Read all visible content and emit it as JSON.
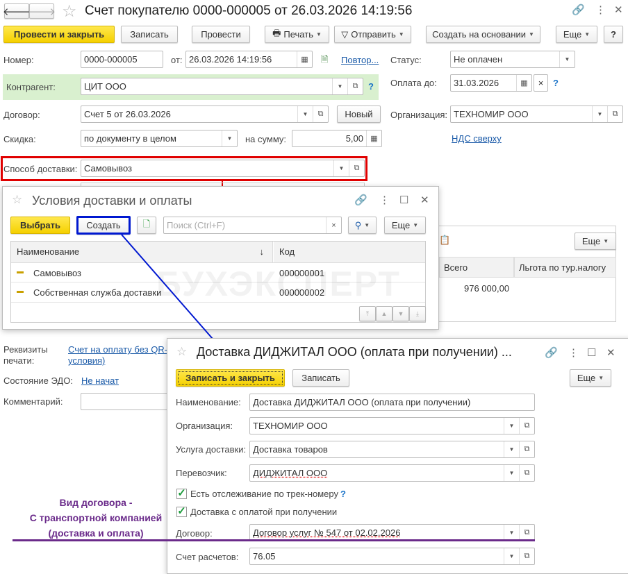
{
  "window": {
    "title": "Счет покупателю 0000-000005 от 26.03.2026 14:19:56"
  },
  "toolbar": {
    "post_close": "Провести и закрыть",
    "save": "Записать",
    "post": "Провести",
    "print": "Печать",
    "send": "Отправить",
    "create_based": "Создать на основании",
    "more": "Еще",
    "help": "?"
  },
  "form": {
    "number_label": "Номер:",
    "number": "0000-000005",
    "date_label": "от:",
    "date": "26.03.2026 14:19:56",
    "repeat_link": "Повтор...",
    "status_label": "Статус:",
    "status": "Не оплачен",
    "counterparty_label": "Контрагент:",
    "counterparty": "ЦИТ ООО",
    "help": "?",
    "pay_until_label": "Оплата до:",
    "pay_until": "31.03.2026",
    "clear": "×",
    "contract_label": "Договор:",
    "contract": "Счет 5 от 26.03.2026",
    "new_button": "Новый",
    "org_label": "Организация:",
    "org": "ТЕХНОМИР ООО",
    "discount_label": "Скидка:",
    "discount": "по документу в целом",
    "sum_label": "на сумму:",
    "sum": "5,00",
    "vat_link": "НДС сверху",
    "delivery_label": "Способ доставки:",
    "delivery": "Самовывоз",
    "print_req_label_1": "Реквизиты",
    "print_req_label_2": "печати:",
    "print_req_link_1": "Счет на оплату без QR-",
    "print_req_link_2": "условия)",
    "edo_label": "Состояние ЭДО:",
    "edo_link": "Не начат",
    "comment_label": "Комментарий:"
  },
  "background_table": {
    "more": "Еще",
    "columns": [
      "Всего",
      "Льгота по тур.налогу"
    ],
    "total": "976 000,00"
  },
  "watermark": "БУХЭКСПЕРТ",
  "dialog1": {
    "title": "Условия доставки и оплаты",
    "select": "Выбрать",
    "create": "Создать",
    "search_placeholder": "Поиск (Ctrl+F)",
    "more": "Еще",
    "columns": [
      "Наименование",
      "Код"
    ],
    "sort_icon": "↓",
    "rows": [
      {
        "name": "Самовывоз",
        "code": "000000001"
      },
      {
        "name": "Собственная служба доставки",
        "code": "000000002"
      }
    ]
  },
  "dialog2": {
    "title": "Доставка ДИДЖИТАЛ ООО (оплата при получении) ...",
    "save_close": "Записать и закрыть",
    "save": "Записать",
    "more": "Еще",
    "name_label": "Наименование:",
    "name": "Доставка ДИДЖИТАЛ ООО (оплата при получении)",
    "org_label": "Организация:",
    "org": "ТЕХНОМИР ООО",
    "service_label": "Услуга доставки:",
    "service": "Доставка товаров",
    "carrier_label": "Перевозчик:",
    "carrier": "ДИДЖИТАЛ ООО",
    "tracking": "Есть отслеживание по трек-номеру",
    "tracking_help": "?",
    "cod": "Доставка с оплатой при получении",
    "contract_label": "Договор:",
    "contract": "Договор услуг № 547 от 02.02.2026",
    "account_label": "Счет расчетов:",
    "account": "76.05"
  },
  "annotation": {
    "line1": "Вид договора -",
    "line2": "С транспортной компанией",
    "line3": "(доставка и оплата)"
  },
  "colors": {
    "yellow": "#f5d000",
    "red_box": "#e00000",
    "blue_box": "#0018d0",
    "purple": "#6a2a8a",
    "link": "#1a5aa8"
  }
}
